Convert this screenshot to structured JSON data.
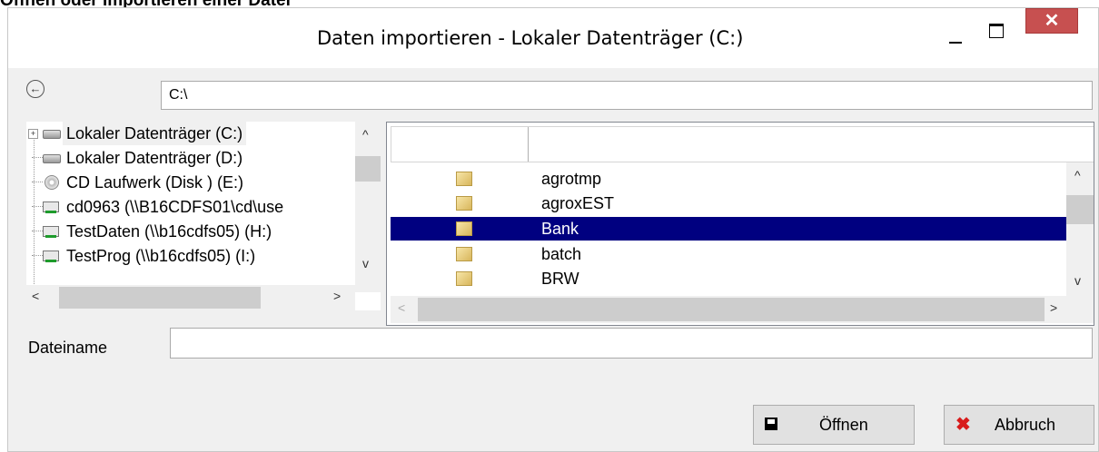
{
  "page_heading": "Öffnen oder Importieren einer Datei",
  "window": {
    "title": "Daten importieren - Lokaler Datenträger (C:)",
    "close_glyph": "✕"
  },
  "path": {
    "value": "C:\\"
  },
  "back_glyph": "←",
  "tree": {
    "items": [
      {
        "label": "Lokaler Datenträger (C:)",
        "icon": "drive-icon",
        "expander": "+"
      },
      {
        "label": "Lokaler Datenträger (D:)",
        "icon": "drive-icon"
      },
      {
        "label": "CD Laufwerk (Disk ) (E:)",
        "icon": "cd-drive-icon"
      },
      {
        "label": "cd0963 (\\\\B16CDFS01\\cd\\use",
        "icon": "network-drive-icon"
      },
      {
        "label": "TestDaten (\\\\b16cdfs05) (H:)",
        "icon": "network-drive-icon"
      },
      {
        "label": "TestProg (\\\\b16cdfs05) (I:)",
        "icon": "network-drive-icon"
      }
    ]
  },
  "files": {
    "rows": [
      {
        "name": "agrotmp"
      },
      {
        "name": "agroxEST"
      },
      {
        "name": "Bank",
        "selected": true
      },
      {
        "name": "batch"
      },
      {
        "name": "BRW"
      }
    ]
  },
  "filename": {
    "label": "Dateiname",
    "value": ""
  },
  "buttons": {
    "open": "Öffnen",
    "cancel": "Abbruch"
  },
  "scroll_glyphs": {
    "up": "^",
    "down": "v",
    "left": "<",
    "right": ">"
  }
}
